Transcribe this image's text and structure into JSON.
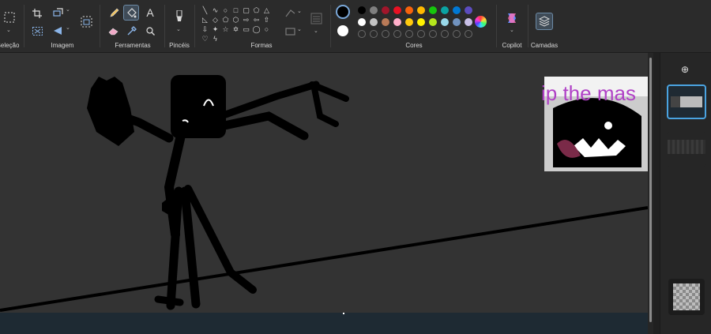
{
  "ribbon": {
    "groups": {
      "selection": "Seleção",
      "image": "Imagem",
      "tools": "Ferramentas",
      "brushes": "Pincéis",
      "shapes": "Formas",
      "colors": "Cores",
      "copilot": "Copilot",
      "layers": "Camadas"
    },
    "text_tool_glyph": "A"
  },
  "colors": {
    "color1": "#000000",
    "color2": "#ffffff",
    "palette_row1": [
      "#000000",
      "#7f7f7f",
      "#a0162b",
      "#e81123",
      "#f7630c",
      "#ffb900",
      "#16c60c",
      "#0ba3a3",
      "#0078d4",
      "#5c4cbf",
      "#b146c2"
    ],
    "palette_row2": [
      "#ffffff",
      "#c3c3c3",
      "#b97a57",
      "#ffaec9",
      "#ffc90e",
      "#fff200",
      "#b5e61d",
      "#99d9ea",
      "#7092be",
      "#c8bfe7"
    ]
  },
  "canvas": {
    "background": "#333333",
    "pasted_text": "ip the mas"
  },
  "layers_panel": {
    "add_layer_glyph": "⊕"
  }
}
